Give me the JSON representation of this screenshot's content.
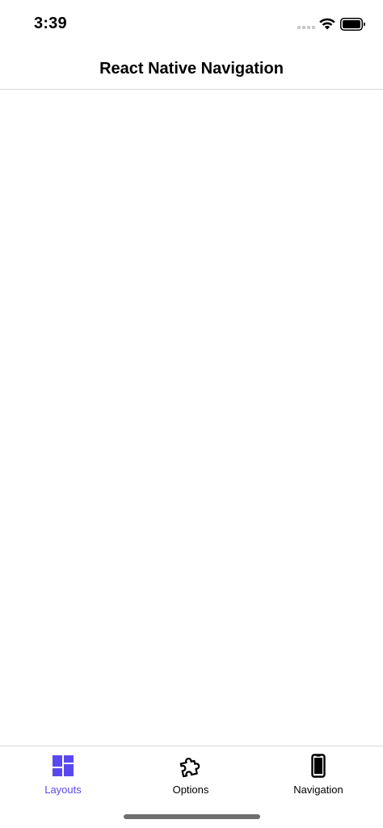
{
  "status_bar": {
    "time": "3:39"
  },
  "header": {
    "title": "React Native Navigation"
  },
  "tabs": [
    {
      "label": "Layouts",
      "icon": "layouts-icon",
      "active": true
    },
    {
      "label": "Options",
      "icon": "puzzle-icon",
      "active": false
    },
    {
      "label": "Navigation",
      "icon": "phone-icon",
      "active": false
    }
  ],
  "colors": {
    "accent": "#5a48ef",
    "inactive": "#000000",
    "divider": "#d9d9d9"
  }
}
